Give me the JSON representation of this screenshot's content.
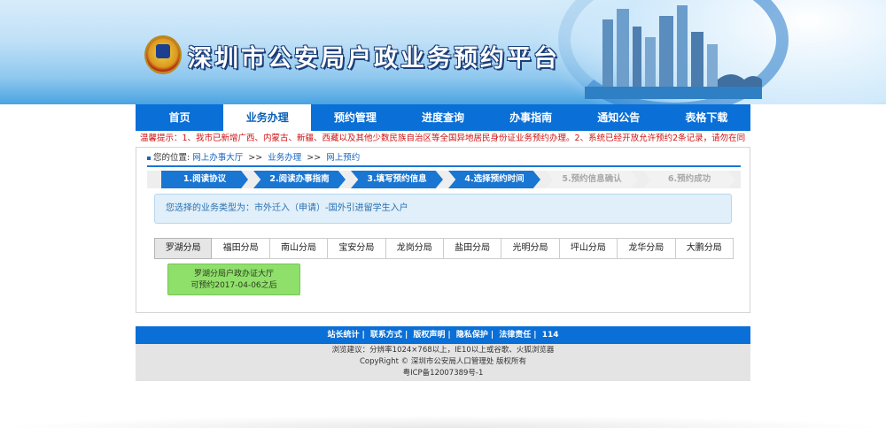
{
  "header": {
    "title": "深圳市公安局户政业务预约平台"
  },
  "nav": {
    "items": [
      "首页",
      "业务办理",
      "预约管理",
      "进度查询",
      "办事指南",
      "通知公告",
      "表格下载"
    ],
    "active_index": 1
  },
  "notice": {
    "text": "温馨提示：1、我市已新增广西、内蒙古、新疆、西藏以及其他少数民族自治区等全国异地居民身份证业务预约办理。2、系统已经开放允许预约2条记录，请勿在同"
  },
  "breadcrumb": {
    "prefix": "您的位置:",
    "items": [
      "网上办事大厅",
      "业务办理",
      "网上预约"
    ],
    "separator": ">>"
  },
  "steps": [
    {
      "label": "1.阅读协议",
      "done": true
    },
    {
      "label": "2.阅读办事指南",
      "done": true
    },
    {
      "label": "3.填写预约信息",
      "done": true
    },
    {
      "label": "4.选择预约时间",
      "done": true
    },
    {
      "label": "5.预约信息确认",
      "done": false
    },
    {
      "label": "6.预约成功",
      "done": false
    }
  ],
  "business_type": {
    "text": "您选择的业务类型为：市外迁入（申请）-国外引进留学生入户"
  },
  "branches": [
    "罗湖分局",
    "福田分局",
    "南山分局",
    "宝安分局",
    "龙岗分局",
    "盐田分局",
    "光明分局",
    "坪山分局",
    "龙华分局",
    "大鹏分局"
  ],
  "selected_branch_index": 0,
  "office": {
    "name": "罗湖分局户政办证大厅",
    "available": "可预约2017-04-06之后"
  },
  "footer": {
    "links": [
      "站长统计",
      "联系方式",
      "版权声明",
      "隐私保护",
      "法律责任",
      "114"
    ],
    "browser_tip": "浏览建议：分辨率1024×768以上，IE10以上或谷歌、火狐浏览器",
    "copyright": "CopyRight © 深圳市公安局人口管理处 版权所有",
    "icp": "粤ICP备12007389号-1"
  },
  "colors": {
    "primary": "#0a6fd6",
    "notice": "#d01010",
    "office_card": "#8fe06b"
  }
}
